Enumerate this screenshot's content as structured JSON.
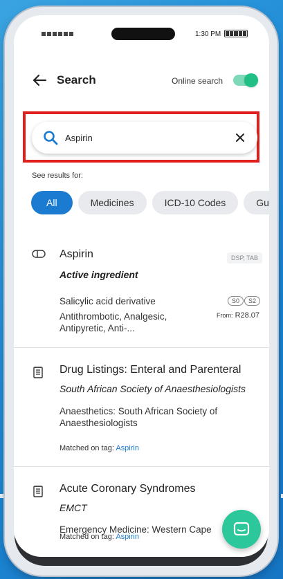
{
  "status_bar": {
    "time": "1:30 PM"
  },
  "header": {
    "title": "Search",
    "online_search_label": "Online search",
    "online_search_enabled": true
  },
  "search": {
    "value": "Aspirin"
  },
  "results_for_label": "See results for:",
  "filter_chips": [
    "All",
    "Medicines",
    "ICD-10 Codes",
    "Guic"
  ],
  "active_chip": "All",
  "results": [
    {
      "title": "Aspirin",
      "subtitle": "Active ingredient",
      "form": "DSP, TAB",
      "description_1": "Salicylic acid derivative",
      "description_2": "Antithrombotic, Analgesic, Antipyretic, Anti-...",
      "schedules": [
        "S0",
        "S2"
      ],
      "price_prefix": "From:",
      "price": "R28.07"
    },
    {
      "title": "Drug Listings: Enteral and Parenteral",
      "subtitle": "South African Society of Anaesthesiologists",
      "description": "Anaesthetics: South African Society of Anaesthesiologists",
      "tag_prefix": "Matched on tag:",
      "tag": "Aspirin"
    },
    {
      "title": "Acute Coronary Syndromes",
      "subtitle": "EMCT",
      "description": "Emergency Medicine: Western Cape",
      "tag_prefix": "Matched on tag:",
      "tag": "Aspirin"
    }
  ],
  "colors": {
    "accent": "#1a7bd1",
    "toggle": "#1fbf86",
    "highlight": "#e0201e",
    "fab": "#2cc79a"
  },
  "icons": {
    "back": "arrow-left-icon",
    "search": "search-icon",
    "clear": "close-icon",
    "medicine": "pill-icon",
    "document": "document-icon",
    "chat": "chat-icon"
  }
}
